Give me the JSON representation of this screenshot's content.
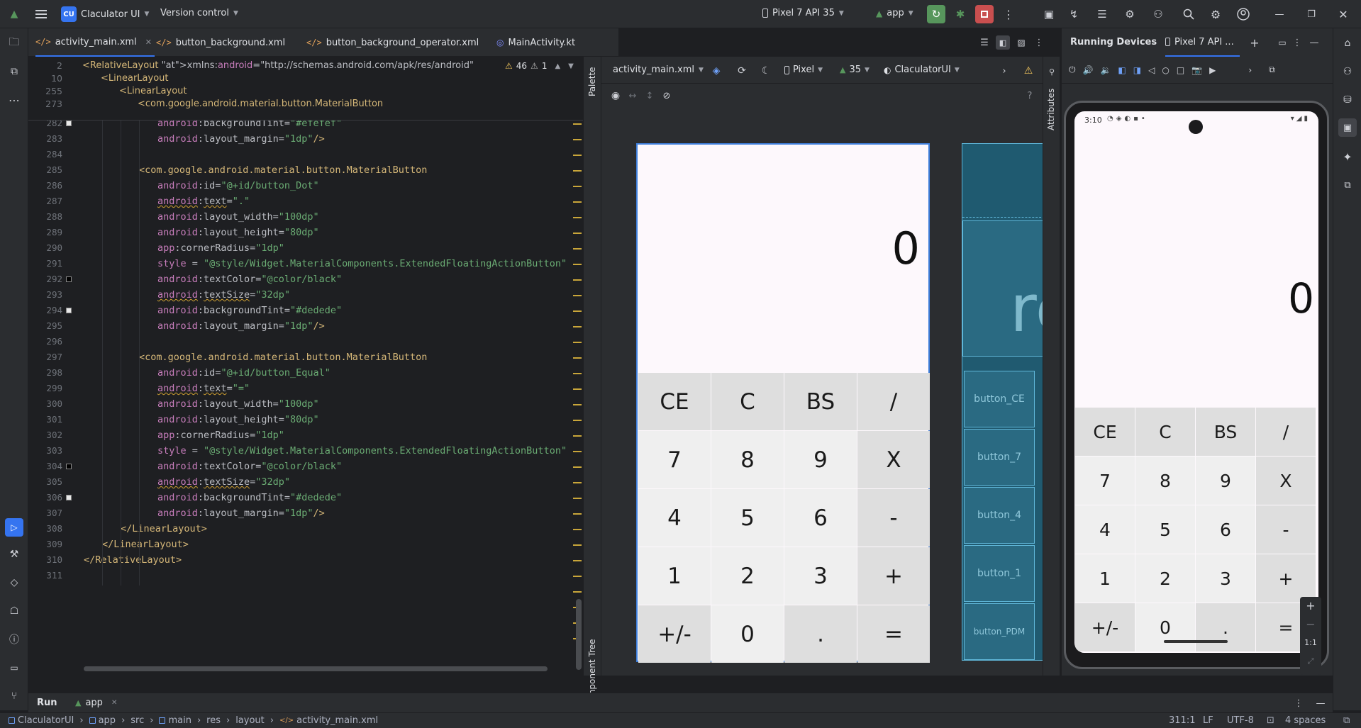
{
  "titlebar": {
    "project_badge": "CU",
    "project_name": "Claculator UI",
    "vcs": "Version control",
    "device": "Pixel 7 API 35",
    "run_config": "app"
  },
  "tabs": [
    {
      "label": "activity_main.xml",
      "active": true
    },
    {
      "label": "button_background.xml"
    },
    {
      "label": "button_background_operator.xml"
    },
    {
      "label": "MainActivity.kt"
    }
  ],
  "editor": {
    "warnings": "46",
    "warnings2": "1",
    "sticky": [
      {
        "ln": "2",
        "code": "<RelativeLayout xmlns:android=\"http://schemas.android.com/apk/res/android\""
      },
      {
        "ln": "10",
        "code": "<LinearLayout"
      },
      {
        "ln": "255",
        "code": "<LinearLayout"
      },
      {
        "ln": "273",
        "code": "<com.google.android.material.button.MaterialButton"
      }
    ],
    "lines": [
      {
        "ln": "282",
        "code": "android:backgroundTint=\"#efefef\""
      },
      {
        "ln": "283",
        "code": "android:layout_margin=\"1dp\"/>"
      },
      {
        "ln": "284",
        "code": ""
      },
      {
        "ln": "285",
        "code": "<com.google.android.material.button.MaterialButton"
      },
      {
        "ln": "286",
        "code": "android:id=\"@+id/button_Dot\""
      },
      {
        "ln": "287",
        "code": "android:text=\".\""
      },
      {
        "ln": "288",
        "code": "android:layout_width=\"100dp\""
      },
      {
        "ln": "289",
        "code": "android:layout_height=\"80dp\""
      },
      {
        "ln": "290",
        "code": "app:cornerRadius=\"1dp\""
      },
      {
        "ln": "291",
        "code": "style = \"@style/Widget.MaterialComponents.ExtendedFloatingActionButton\""
      },
      {
        "ln": "292",
        "code": "android:textColor=\"@color/black\""
      },
      {
        "ln": "293",
        "code": "android:textSize=\"32dp\""
      },
      {
        "ln": "294",
        "code": "android:backgroundTint=\"#dedede\""
      },
      {
        "ln": "295",
        "code": "android:layout_margin=\"1dp\"/>"
      },
      {
        "ln": "296",
        "code": ""
      },
      {
        "ln": "297",
        "code": "<com.google.android.material.button.MaterialButton"
      },
      {
        "ln": "298",
        "code": "android:id=\"@+id/button_Equal\""
      },
      {
        "ln": "299",
        "code": "android:text=\"=\""
      },
      {
        "ln": "300",
        "code": "android:layout_width=\"100dp\""
      },
      {
        "ln": "301",
        "code": "android:layout_height=\"80dp\""
      },
      {
        "ln": "302",
        "code": "app:cornerRadius=\"1dp\""
      },
      {
        "ln": "303",
        "code": "style = \"@style/Widget.MaterialComponents.ExtendedFloatingActionButton\""
      },
      {
        "ln": "304",
        "code": "android:textColor=\"@color/black\""
      },
      {
        "ln": "305",
        "code": "android:textSize=\"32dp\""
      },
      {
        "ln": "306",
        "code": "android:backgroundTint=\"#dedede\""
      },
      {
        "ln": "307",
        "code": "android:layout_margin=\"1dp\"/>"
      },
      {
        "ln": "308",
        "code": "</LinearLayout>"
      },
      {
        "ln": "309",
        "code": "</LinearLayout>"
      },
      {
        "ln": "310",
        "code": "</RelativeLayout>"
      },
      {
        "ln": "311",
        "code": ""
      }
    ]
  },
  "side_labels": {
    "palette": "Palette",
    "component_tree": "Component Tree",
    "attributes": "Attributes"
  },
  "design": {
    "file": "activity_main.xml",
    "device": "Pixel",
    "api": "35",
    "theme": "ClaculatorUI",
    "display": "0"
  },
  "calculator_keys": [
    [
      "CE",
      "C",
      "BS",
      "/"
    ],
    [
      "7",
      "8",
      "9",
      "X"
    ],
    [
      "4",
      "5",
      "6",
      "-"
    ],
    [
      "1",
      "2",
      "3",
      "+"
    ],
    [
      "+/-",
      "0",
      ".",
      "="
    ]
  ],
  "blueprint": {
    "text": "re",
    "buttons": [
      "button_CE",
      "button_7",
      "button_4",
      "button_1",
      "button_PDM"
    ]
  },
  "running_devices": {
    "title": "Running Devices",
    "device_tab": "Pixel 7 API ...",
    "time": "3:10",
    "display": "0",
    "zoom": "1:1"
  },
  "run": {
    "label": "Run",
    "config": "app"
  },
  "breadcrumb": [
    "ClaculatorUI",
    "app",
    "src",
    "main",
    "res",
    "layout",
    "activity_main.xml"
  ],
  "status": {
    "position": "311:1",
    "line_sep": "LF",
    "encoding": "UTF-8",
    "indent": "4 spaces"
  }
}
